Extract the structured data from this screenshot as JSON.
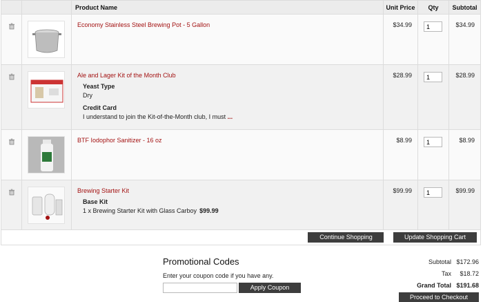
{
  "table": {
    "headers": {
      "product": "Product Name",
      "unit_price": "Unit Price",
      "qty": "Qty",
      "subtotal": "Subtotal"
    }
  },
  "items": [
    {
      "name": "Economy Stainless Steel Brewing Pot - 5 Gallon",
      "unit_price": "$34.99",
      "qty": "1",
      "subtotal": "$34.99",
      "image": "pot"
    },
    {
      "name": "Ale and Lager Kit of the Month Club",
      "unit_price": "$28.99",
      "qty": "1",
      "subtotal": "$28.99",
      "image": "kit-box",
      "options": [
        {
          "label": "Yeast Type",
          "value": "Dry"
        },
        {
          "label": "Credit Card",
          "value": "I understand to join the Kit-of-the-Month club, I must",
          "more": "..."
        }
      ]
    },
    {
      "name": "BTF Iodophor Sanitizer - 16 oz",
      "unit_price": "$8.99",
      "qty": "1",
      "subtotal": "$8.99",
      "image": "bottle"
    },
    {
      "name": "Brewing Starter Kit",
      "unit_price": "$99.99",
      "qty": "1",
      "subtotal": "$99.99",
      "image": "starter-kit",
      "options": [
        {
          "label": "Base Kit",
          "value": "1 x Brewing Starter Kit with Glass Carboy",
          "price": "$99.99"
        }
      ]
    }
  ],
  "actions": {
    "continue": "Continue Shopping",
    "update": "Update Shopping Cart"
  },
  "promo": {
    "title": "Promotional Codes",
    "hint": "Enter your coupon code if you have any.",
    "coupon_value": "",
    "apply": "Apply Coupon"
  },
  "totals": {
    "subtotal_label": "Subtotal",
    "subtotal": "$172.96",
    "tax_label": "Tax",
    "tax": "$18.72",
    "grand_label": "Grand Total",
    "grand": "$191.68",
    "checkout": "Proceed to Checkout"
  },
  "icons": {
    "remove": "trash-icon"
  },
  "colors": {
    "link": "#a31212",
    "button": "#3d3d3d",
    "header_bg": "#ececec"
  }
}
